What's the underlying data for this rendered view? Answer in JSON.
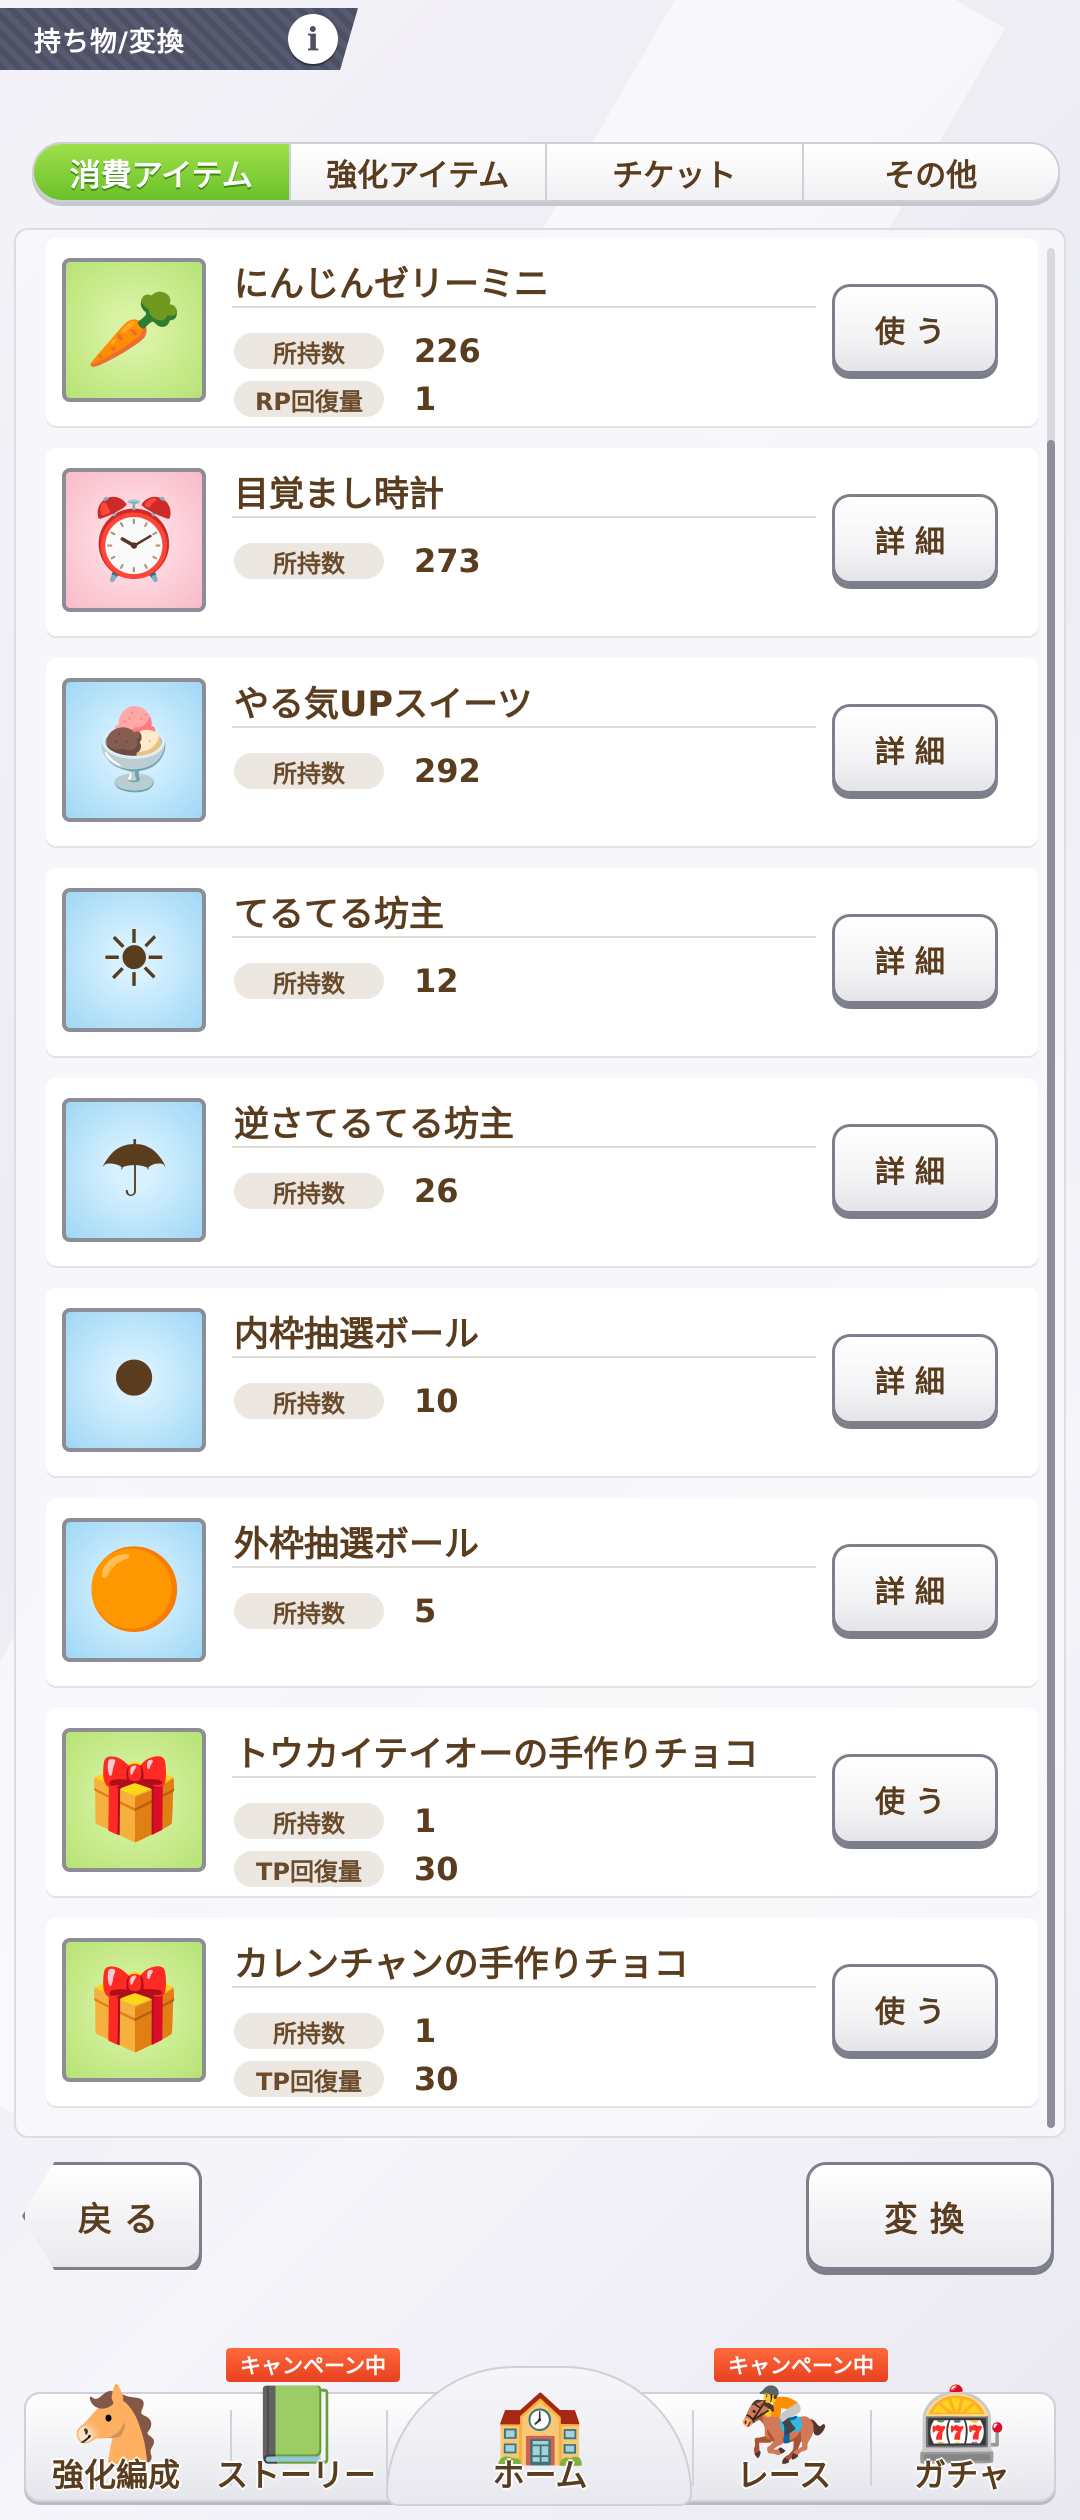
{
  "header": {
    "title": "持ち物/変換",
    "info_label": "i"
  },
  "tabs": [
    {
      "label": "消費アイテム",
      "active": true
    },
    {
      "label": "強化アイテム",
      "active": false
    },
    {
      "label": "チケット",
      "active": false
    },
    {
      "label": "その他",
      "active": false
    }
  ],
  "items": [
    {
      "name": "にんじんゼリーミニ",
      "icon": "carrot-jelly-icon",
      "glyph": "🥕",
      "bg": "green",
      "stats": [
        {
          "label": "所持数",
          "value": "226"
        },
        {
          "label": "RP回復量",
          "value": "1"
        }
      ],
      "action": "使う"
    },
    {
      "name": "目覚まし時計",
      "icon": "alarm-clock-icon",
      "glyph": "⏰",
      "bg": "pink",
      "stats": [
        {
          "label": "所持数",
          "value": "273"
        }
      ],
      "action": "詳細"
    },
    {
      "name": "やる気UPスイーツ",
      "icon": "parfait-icon",
      "glyph": "🍨",
      "bg": "blue",
      "stats": [
        {
          "label": "所持数",
          "value": "292"
        }
      ],
      "action": "詳細"
    },
    {
      "name": "てるてる坊主",
      "icon": "teru-teru-bozu-icon",
      "glyph": "☀",
      "bg": "blue",
      "stats": [
        {
          "label": "所持数",
          "value": "12"
        }
      ],
      "action": "詳細"
    },
    {
      "name": "逆さてるてる坊主",
      "icon": "reverse-teru-teru-bozu-icon",
      "glyph": "☂",
      "bg": "blue",
      "stats": [
        {
          "label": "所持数",
          "value": "26"
        }
      ],
      "action": "詳細"
    },
    {
      "name": "内枠抽選ボール",
      "icon": "inner-lottery-balls-icon",
      "glyph": "⚫",
      "bg": "blue",
      "stats": [
        {
          "label": "所持数",
          "value": "10"
        }
      ],
      "action": "詳細"
    },
    {
      "name": "外枠抽選ボール",
      "icon": "outer-lottery-balls-icon",
      "glyph": "🟠",
      "bg": "blue",
      "stats": [
        {
          "label": "所持数",
          "value": "5"
        }
      ],
      "action": "詳細"
    },
    {
      "name": "トウカイテイオーの手作りチョコ",
      "icon": "chocolate-gift-icon",
      "glyph": "🎁",
      "bg": "green",
      "stats": [
        {
          "label": "所持数",
          "value": "1"
        },
        {
          "label": "TP回復量",
          "value": "30"
        }
      ],
      "action": "使う"
    },
    {
      "name": "カレンチャンの手作りチョコ",
      "icon": "chocolate-gift-icon",
      "glyph": "🎁",
      "bg": "green",
      "stats": [
        {
          "label": "所持数",
          "value": "1"
        },
        {
          "label": "TP回復量",
          "value": "30"
        }
      ],
      "action": "使う"
    }
  ],
  "footer": {
    "back_label": "戻る",
    "convert_label": "変換"
  },
  "nav": [
    {
      "label": "強化編成",
      "icon": "uma-girl-icon",
      "glyph": "🐴",
      "campaign": ""
    },
    {
      "label": "ストーリー",
      "icon": "story-book-icon",
      "glyph": "📗",
      "campaign": "キャンペーン中"
    },
    {
      "label": "ホーム",
      "icon": "home-building-icon",
      "glyph": "🏫",
      "campaign": ""
    },
    {
      "label": "レース",
      "icon": "race-gate-icon",
      "glyph": "🏇",
      "campaign": "キャンペーン中"
    },
    {
      "label": "ガチャ",
      "icon": "gacha-icon",
      "glyph": "🎰",
      "campaign": ""
    }
  ]
}
